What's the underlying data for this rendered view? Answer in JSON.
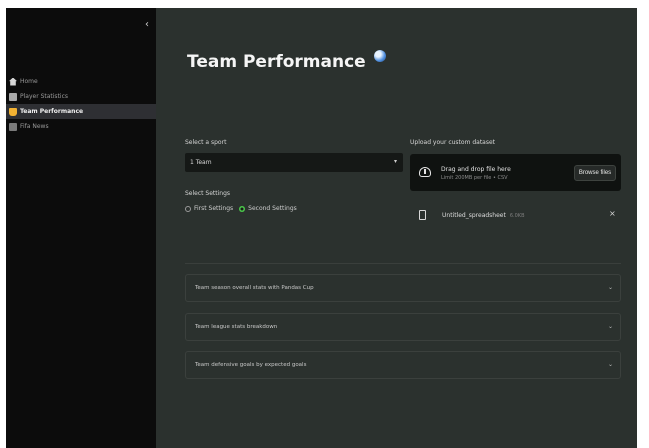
{
  "sidebar": {
    "collapse_glyph": "‹",
    "items": [
      {
        "label": "Home",
        "icon": "home-icon",
        "active": false
      },
      {
        "label": "Player Statistics",
        "icon": "stats-icon",
        "active": false
      },
      {
        "label": "Team Performance",
        "icon": "trophy-icon",
        "active": true
      },
      {
        "label": "Fifa News",
        "icon": "news-icon",
        "active": false
      }
    ]
  },
  "main": {
    "title": "Team Performance",
    "select_league_label": "Select a sport",
    "select_league_value": "1 Team",
    "select_settings_label": "Select Settings",
    "settings_options": [
      {
        "label": "First Settings",
        "selected": false
      },
      {
        "label": "Second Settings",
        "selected": true
      }
    ],
    "upload_label": "Upload your custom dataset",
    "uploader": {
      "drag_text": "Drag and drop file here",
      "limit_text": "Limit 200MB per file • CSV",
      "browse_label": "Browse files"
    },
    "uploaded_file": {
      "name": "Untitled_spreadsheet",
      "size": "6.0KB",
      "remove_glyph": "×"
    },
    "expanders": [
      {
        "label": "Team season overall stats with Pandas Cup",
        "caret": "⌄"
      },
      {
        "label": "Team league stats breakdown",
        "caret": "⌄"
      },
      {
        "label": "Team defensive goals by expected goals",
        "caret": "⌄"
      }
    ]
  },
  "colors": {
    "sidebar_bg": "#0c0c0c",
    "main_bg": "#2b312e",
    "active_item_bg": "#2e2f33",
    "radio_selected": "#4cc94c",
    "trophy_accent": "#f2b233"
  }
}
